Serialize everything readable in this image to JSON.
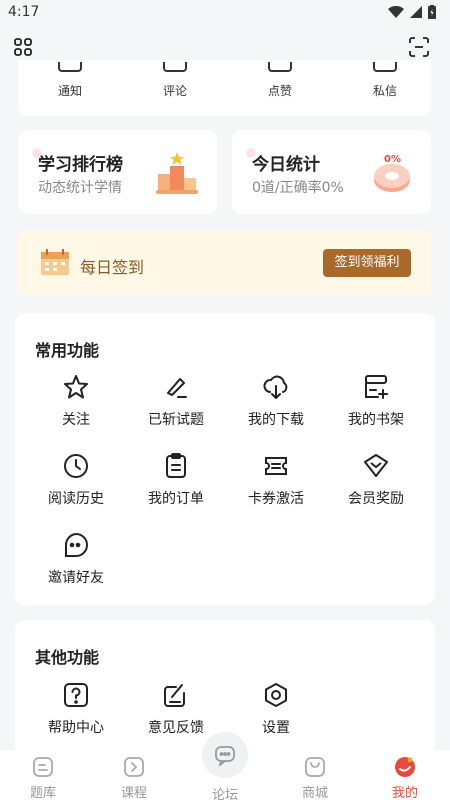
{
  "status_bar": {
    "time": "4:17"
  },
  "messages": [
    {
      "label": "通知"
    },
    {
      "label": "评论"
    },
    {
      "label": "点赞"
    },
    {
      "label": "私信"
    }
  ],
  "ranking": {
    "title": "学习排行榜",
    "subtitle": "动态统计学情"
  },
  "today": {
    "title": "今日统计",
    "subtitle": "0道/正确率0%",
    "badge": "0%"
  },
  "signin": {
    "label": "每日签到",
    "button": "签到领福利"
  },
  "common": {
    "title": "常用功能",
    "items": [
      {
        "label": "关注",
        "icon": "star-icon"
      },
      {
        "label": "已斩试题",
        "icon": "knife-icon"
      },
      {
        "label": "我的下载",
        "icon": "cloud-download-icon"
      },
      {
        "label": "我的书架",
        "icon": "bookshelf-icon"
      },
      {
        "label": "阅读历史",
        "icon": "clock-icon"
      },
      {
        "label": "我的订单",
        "icon": "clipboard-icon"
      },
      {
        "label": "卡券激活",
        "icon": "ticket-icon"
      },
      {
        "label": "会员奖励",
        "icon": "diamond-icon"
      },
      {
        "label": "邀请好友",
        "icon": "chat-bubble-icon"
      }
    ]
  },
  "other": {
    "title": "其他功能",
    "items": [
      {
        "label": "帮助中心",
        "icon": "help-icon"
      },
      {
        "label": "意见反馈",
        "icon": "feedback-icon"
      },
      {
        "label": "设置",
        "icon": "settings-icon"
      }
    ]
  },
  "nav": [
    {
      "label": "题库"
    },
    {
      "label": "课程"
    },
    {
      "label": "论坛"
    },
    {
      "label": "商城"
    },
    {
      "label": "我的"
    }
  ],
  "colors": {
    "accent": "#e74a3b",
    "gold_button": "#a9692a",
    "signin_bg": "#fff8e6"
  }
}
